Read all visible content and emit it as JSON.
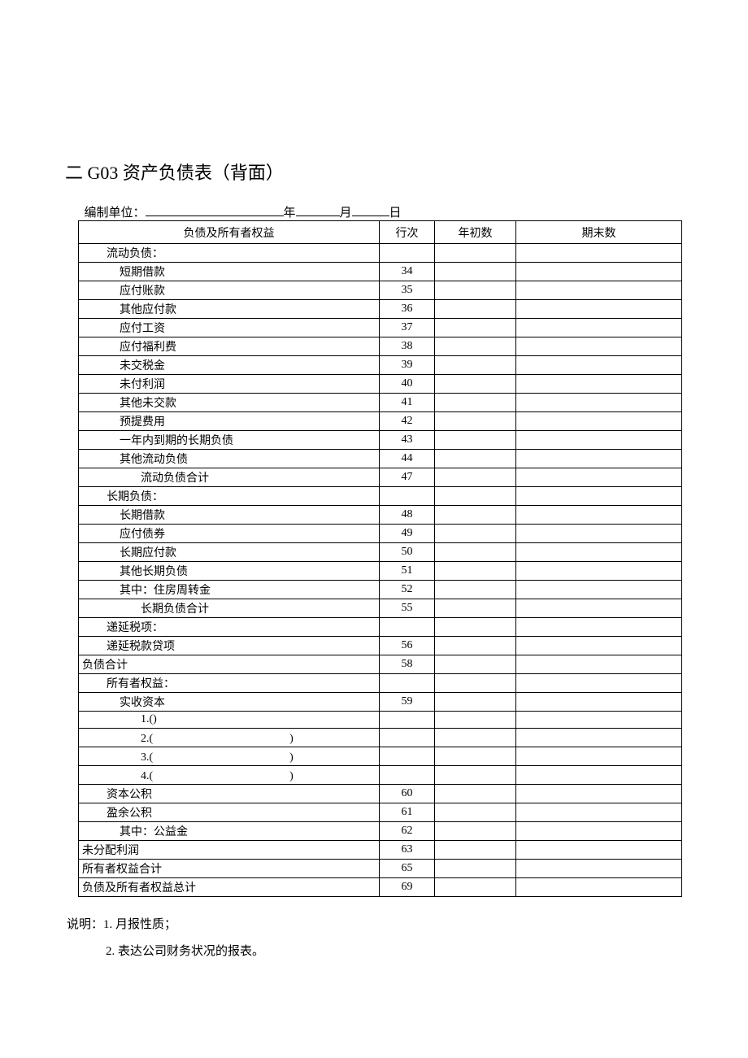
{
  "title": "二 G03 资产负债表（背面）",
  "meta": {
    "label_unit": "编制单位：",
    "label_year": "年",
    "label_month": "月",
    "label_day": "日"
  },
  "headers": {
    "c1": "负债及所有者权益",
    "c2": "行次",
    "c3": "年初数",
    "c4": "期末数"
  },
  "rows": [
    {
      "label": "流动负债：",
      "row": "",
      "ind": 1,
      "cls": ""
    },
    {
      "label": "短期借款",
      "row": "34",
      "ind": 2,
      "cls": ""
    },
    {
      "label": "应付账款",
      "row": "35",
      "ind": 2,
      "cls": ""
    },
    {
      "label": "其他应付款",
      "row": "36",
      "ind": 2,
      "cls": ""
    },
    {
      "label": "应付工资",
      "row": "37",
      "ind": 2,
      "cls": ""
    },
    {
      "label": "应付福利费",
      "row": "38",
      "ind": 2,
      "cls": ""
    },
    {
      "label": "未交税金",
      "row": "39",
      "ind": 2,
      "cls": ""
    },
    {
      "label": "未付利润",
      "row": "40",
      "ind": 2,
      "cls": ""
    },
    {
      "label": "其他未交款",
      "row": "41",
      "ind": 2,
      "cls": ""
    },
    {
      "label": "预提费用",
      "row": "42",
      "ind": 2,
      "cls": ""
    },
    {
      "label": "一年内到期的长期负债",
      "row": "43",
      "ind": 2,
      "cls": ""
    },
    {
      "label": "其他流动负债",
      "row": "44",
      "ind": 2,
      "cls": ""
    },
    {
      "label": "流动负债合计",
      "row": "47",
      "ind": 3,
      "cls": ""
    },
    {
      "label": "长期负债：",
      "row": "",
      "ind": 1,
      "cls": ""
    },
    {
      "label": "长期借款",
      "row": "48",
      "ind": 2,
      "cls": ""
    },
    {
      "label": "应付债券",
      "row": "49",
      "ind": 2,
      "cls": ""
    },
    {
      "label": "长期应付款",
      "row": "50",
      "ind": 2,
      "cls": ""
    },
    {
      "label": "其他长期负债",
      "row": "51",
      "ind": 2,
      "cls": ""
    },
    {
      "label": "其中：住房周转金",
      "row": "52",
      "ind": 2,
      "cls": ""
    },
    {
      "label": "长期负债合计",
      "row": "55",
      "ind": 3,
      "cls": ""
    },
    {
      "label": "递延税项：",
      "row": "",
      "ind": 1,
      "cls": ""
    },
    {
      "label": "递延税款贷项",
      "row": "56",
      "ind": 1,
      "cls": ""
    },
    {
      "label": "负债合计",
      "row": "58",
      "ind": 0,
      "cls": "center"
    },
    {
      "label": "所有者权益：",
      "row": "",
      "ind": 1,
      "cls": ""
    },
    {
      "label": "实收资本",
      "row": "59",
      "ind": 2,
      "cls": ""
    },
    {
      "label": "1.()",
      "row": "",
      "ind": 3,
      "cls": ""
    },
    {
      "label": "2.(　　　　　　　　　　　　)",
      "row": "",
      "ind": 3,
      "cls": ""
    },
    {
      "label": "3.(　　　　　　　　　　　　)",
      "row": "",
      "ind": 3,
      "cls": ""
    },
    {
      "label": "4.(　　　　　　　　　　　　)",
      "row": "",
      "ind": 3,
      "cls": ""
    },
    {
      "label": "资本公积",
      "row": "60",
      "ind": 1,
      "cls": ""
    },
    {
      "label": "盈余公积",
      "row": "61",
      "ind": 1,
      "cls": ""
    },
    {
      "label": "其中：公益金",
      "row": "62",
      "ind": 2,
      "cls": ""
    },
    {
      "label": "未分配利润",
      "row": "63",
      "ind": 0,
      "cls": ""
    },
    {
      "label": "所有者权益合计",
      "row": "65",
      "ind": 0,
      "cls": ""
    },
    {
      "label": "负债及所有者权益总计",
      "row": "69",
      "ind": 0,
      "cls": ""
    }
  ],
  "notes": {
    "n1": "说明：1. 月报性质；",
    "n2": "2. 表达公司财务状况的报表。"
  }
}
